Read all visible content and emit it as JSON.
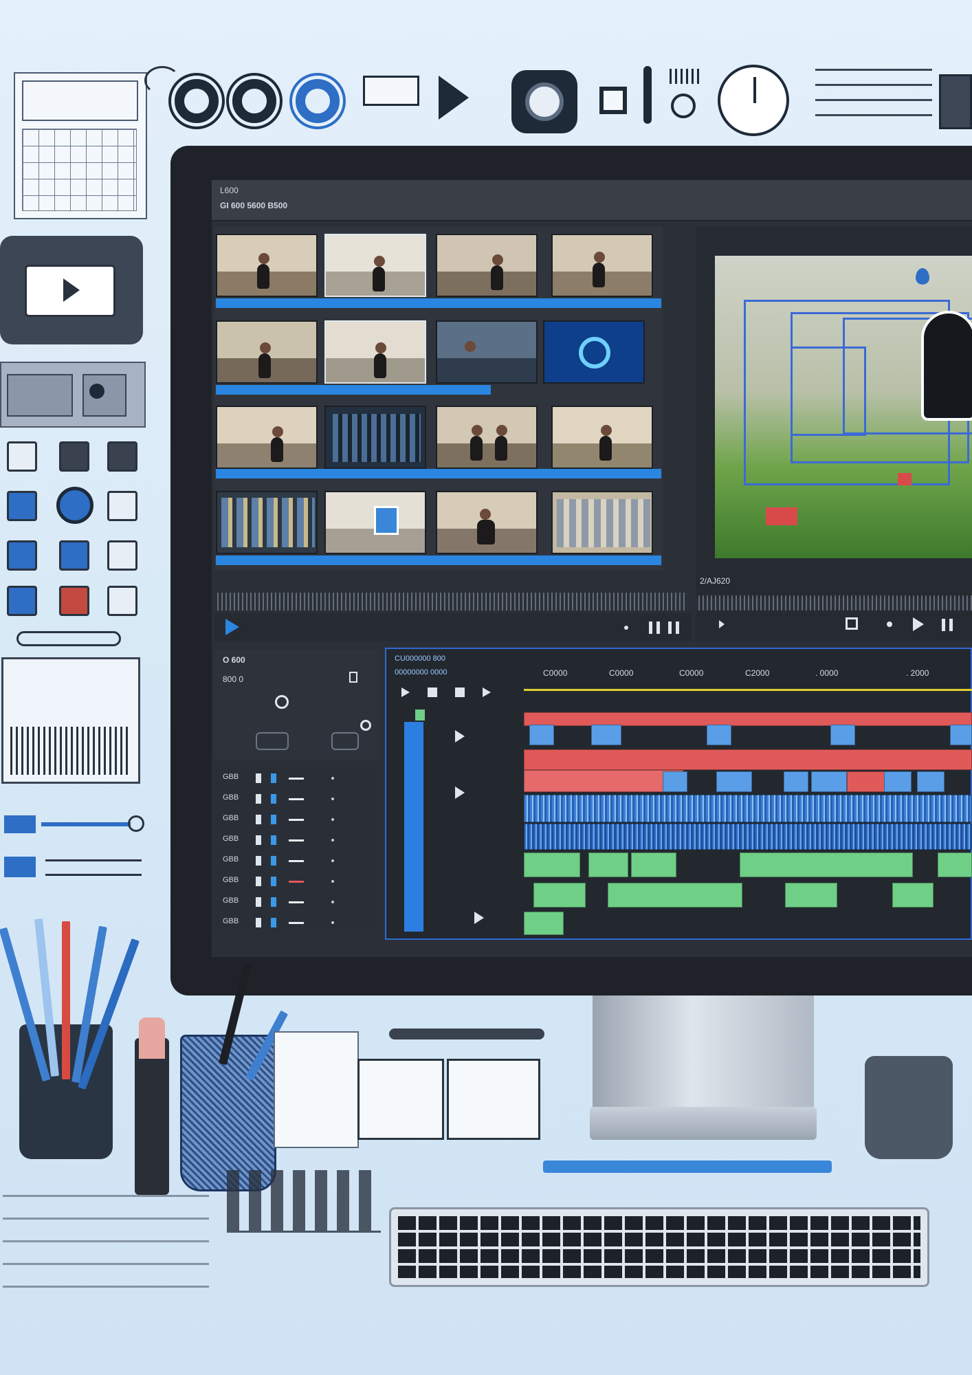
{
  "app": {
    "title": "L600",
    "subtitle": "GI 600 5600 B500"
  },
  "preview": {
    "timecode": "2/AJ620"
  },
  "fx_panel": {
    "title": "O 600",
    "label": "800 0"
  },
  "timeline": {
    "header_line1": "CU000000 800",
    "header_line2": "00000000 0000",
    "ruler_labels": [
      "C0000",
      "C0000",
      "C0000",
      "C2000",
      ". 0000",
      ". 2000"
    ]
  },
  "tracks": [
    {
      "label": "GBB"
    },
    {
      "label": "GBB"
    },
    {
      "label": "GBB"
    },
    {
      "label": "GBB"
    },
    {
      "label": "GBB"
    },
    {
      "label": "GBB"
    },
    {
      "label": "GBB"
    },
    {
      "label": "GBB"
    }
  ],
  "colors": {
    "accent": "#2a86e0",
    "timeline_border": "#2f6ad0",
    "video_clip": "#e05a5a",
    "audio_clip": "#3c7fd8",
    "green_clip": "#6fcf87",
    "playhead_line": "#e0d030"
  },
  "icons": {
    "toolbar": [
      "settings-gear-icon",
      "settings-gear-icon",
      "blue-gear-icon",
      "layout-icon",
      "shape-icon",
      "record-icon",
      "stop-icon",
      "brush-icon",
      "clock-icon",
      "list-icon",
      "image-icon"
    ],
    "left_tools": [
      "play-icon",
      "panel-icon",
      "grid-icon"
    ]
  }
}
